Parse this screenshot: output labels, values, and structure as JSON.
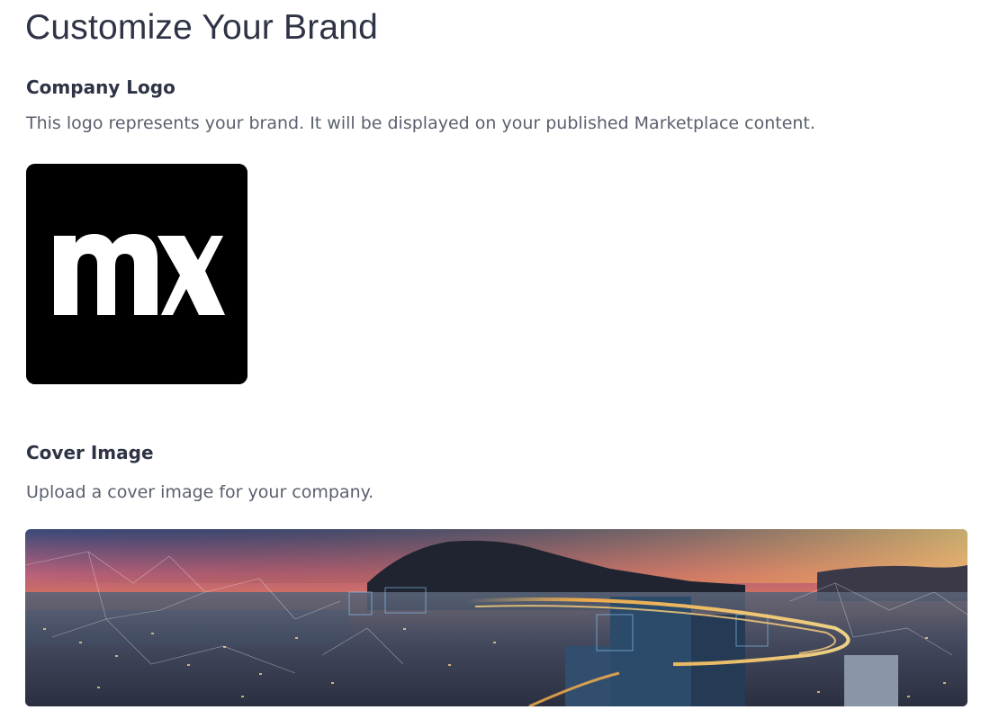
{
  "page": {
    "title": "Customize Your Brand"
  },
  "company_logo": {
    "heading": "Company Logo",
    "description": "This logo represents your brand. It will be displayed on your published Marketplace content.",
    "logo_text": "mx",
    "logo_background": "#000000",
    "logo_foreground": "#ffffff"
  },
  "cover_image": {
    "heading": "Cover Image",
    "description": "Upload a cover image for your company."
  },
  "colors": {
    "heading_text": "#2e3445",
    "body_text": "#5a606e",
    "background": "#ffffff"
  }
}
